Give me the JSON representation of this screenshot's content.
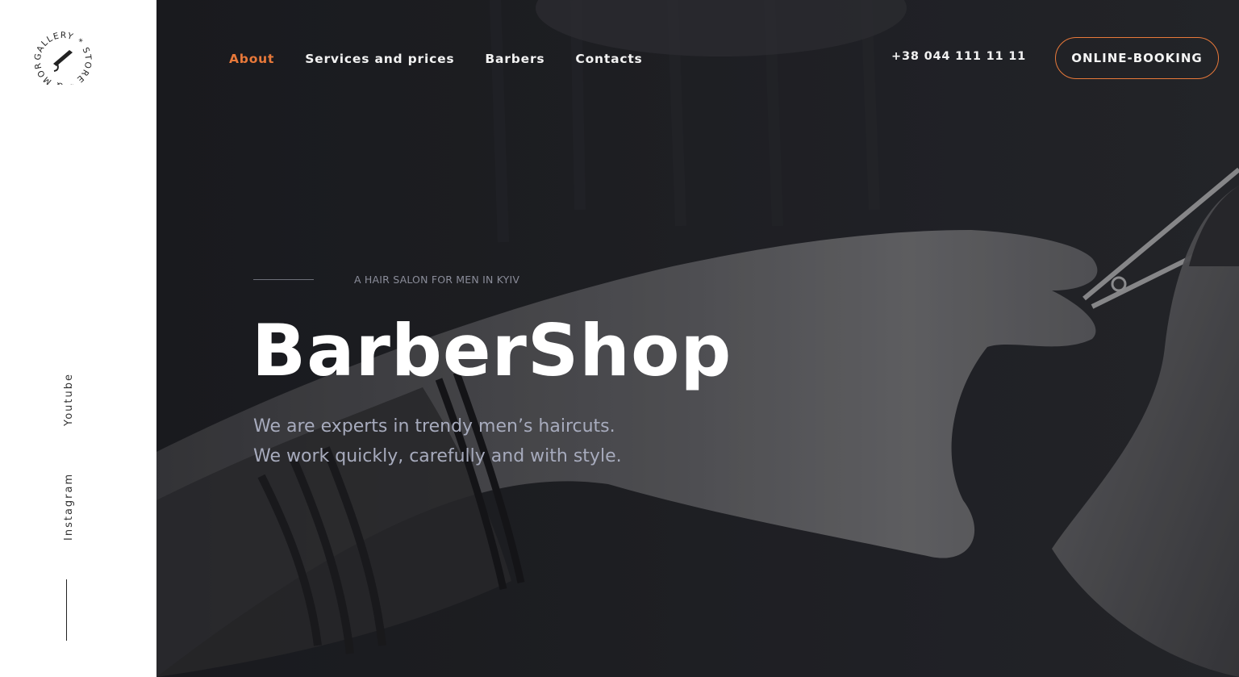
{
  "logo": {
    "text": "GALLERY * STORE * & MORE *",
    "icon": "razor-icon"
  },
  "social": {
    "youtube": "Youtube",
    "instagram": "Instagram"
  },
  "nav": {
    "items": [
      {
        "label": "About",
        "active": true
      },
      {
        "label": "Services and prices",
        "active": false
      },
      {
        "label": "Barbers",
        "active": false
      },
      {
        "label": "Contacts",
        "active": false
      }
    ]
  },
  "header": {
    "phone": "+38 044 111 11 11",
    "booking_label": "ONLINE-BOOKING"
  },
  "hero": {
    "eyebrow": "A HAIR SALON FOR MEN IN KYIV",
    "title": "BarberShop",
    "subtitle_line1": "We are experts in trendy men’s haircuts.",
    "subtitle_line2": "We work quickly, carefully and with style."
  },
  "colors": {
    "accent": "#e8793a",
    "hero_background": "#1c1d20",
    "sidebar_background": "#ffffff"
  }
}
